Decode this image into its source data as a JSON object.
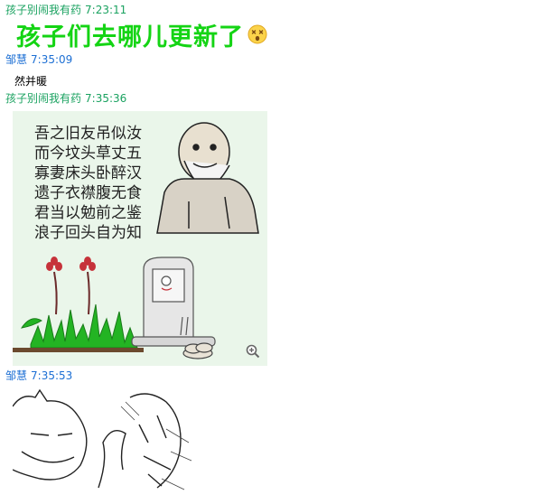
{
  "messages": [
    {
      "sender": "孩子别闹我有药",
      "time": "7:23:11",
      "sender_color": "#1aa260",
      "content": "孩子们去哪儿更新了",
      "content_color": "#14d414",
      "emoji": "dizzy-face-emoji"
    },
    {
      "sender": "邹慧",
      "time": "7:35:09",
      "sender_color": "#1c6fd4",
      "content": "然并暖"
    },
    {
      "sender": "孩子别闹我有药",
      "time": "7:35:36",
      "sender_color": "#1aa260",
      "image": {
        "poem_lines": [
          "吾之旧友吊似汝",
          "而今坟头草丈五",
          "寡妻床头卧醉汉",
          "遗子衣襟腹无食",
          "君当以勉前之鉴",
          "浪子回头自为知"
        ]
      }
    },
    {
      "sender": "邹慧",
      "time": "7:35:53",
      "sender_color": "#1c6fd4",
      "image": {
        "description_icon": "rage-comic-sketch"
      }
    }
  ]
}
